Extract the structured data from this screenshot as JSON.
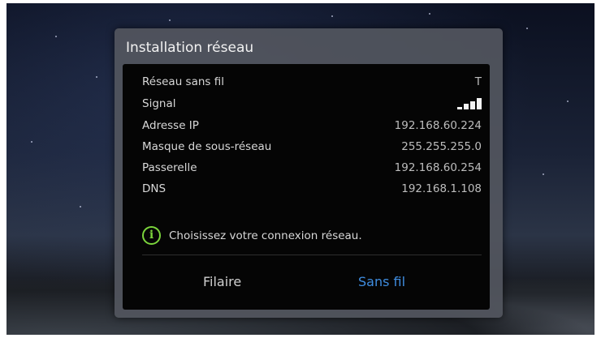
{
  "dialog": {
    "title": "Installation réseau",
    "rows": [
      {
        "label": "Réseau sans fil",
        "value": "T"
      },
      {
        "label": "Signal",
        "value": ""
      },
      {
        "label": "Adresse IP",
        "value": "192.168.60.224"
      },
      {
        "label": "Masque de sous-réseau",
        "value": "255.255.255.0"
      },
      {
        "label": "Passerelle",
        "value": "192.168.60.254"
      },
      {
        "label": "DNS",
        "value": "192.168.1.108"
      }
    ],
    "signal_strength": {
      "filled_bars": 4,
      "total_bars": 4
    },
    "info_icon": "info-icon",
    "info_message": "Choisissez votre connexion réseau.",
    "buttons": {
      "wired": "Filaire",
      "wireless": "Sans fil"
    }
  },
  "colors": {
    "accent_selected": "#3f8de0",
    "info_green": "#7bd43c"
  }
}
